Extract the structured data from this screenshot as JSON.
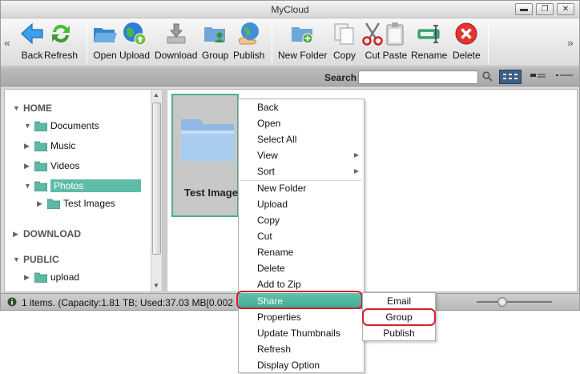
{
  "window": {
    "title": "MyCloud"
  },
  "toolbar": {
    "left_nav": "«",
    "right_nav": "»",
    "buttons": [
      {
        "label": "Back",
        "icon": "back-arrow-icon"
      },
      {
        "label": "Refresh",
        "icon": "refresh-icon"
      },
      {
        "label": "Open",
        "icon": "open-folder-icon"
      },
      {
        "label": "Upload",
        "icon": "upload-globe-icon"
      },
      {
        "label": "Download",
        "icon": "download-icon"
      },
      {
        "label": "Group",
        "icon": "group-icon"
      },
      {
        "label": "Publish",
        "icon": "publish-icon"
      },
      {
        "label": "New Folder",
        "icon": "new-folder-icon"
      },
      {
        "label": "Copy",
        "icon": "copy-icon"
      },
      {
        "label": "Cut",
        "icon": "scissors-icon"
      },
      {
        "label": "Paste",
        "icon": "clipboard-icon"
      },
      {
        "label": "Rename",
        "icon": "rename-icon"
      },
      {
        "label": "Delete",
        "icon": "delete-icon"
      }
    ]
  },
  "search": {
    "label": "Search",
    "value": "",
    "placeholder": ""
  },
  "sidebar": {
    "home": "HOME",
    "download": "DOWNLOAD",
    "public": "PUBLIC",
    "items": {
      "documents": "Documents",
      "music": "Music",
      "videos": "Videos",
      "photos": "Photos",
      "test_images": "Test Images",
      "upload": "upload"
    }
  },
  "main": {
    "tile_label": "Test Images"
  },
  "status": {
    "text": "1 items. (Capacity:1.81 TB; Used:37.03 MB[0.002"
  },
  "context_menu": {
    "items": [
      "Back",
      "Open",
      "Select All",
      "View",
      "Sort",
      "New Folder",
      "Upload",
      "Copy",
      "Cut",
      "Rename",
      "Delete",
      "Add to Zip",
      "Share",
      "Properties",
      "Update Thumbnails",
      "Refresh",
      "Display Option"
    ],
    "submenu_arrow": "▶"
  },
  "share_submenu": {
    "items": [
      "Email",
      "Group",
      "Publish"
    ]
  },
  "colors": {
    "accent": "#5ebca8",
    "highlight_ring": "#d4202b",
    "view_active": "#3c5f86"
  }
}
